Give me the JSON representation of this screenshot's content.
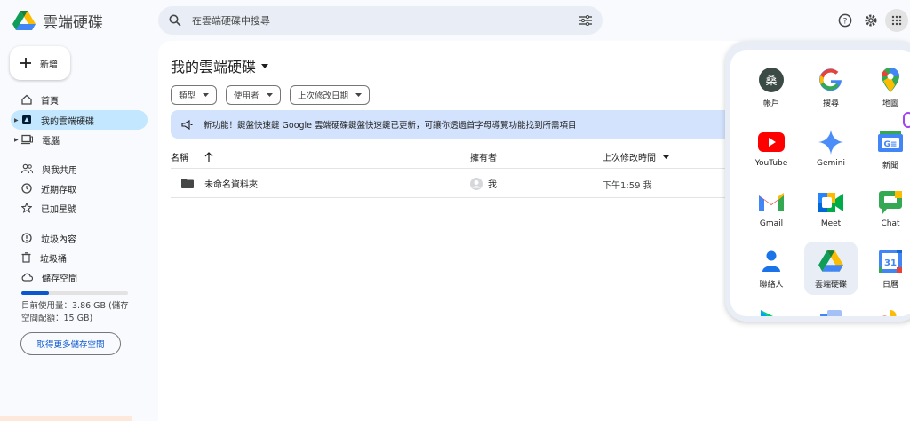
{
  "header": {
    "title": "雲端硬碟",
    "search_placeholder": "在雲端硬碟中搜尋",
    "icons": [
      "drive-logo-icon",
      "search-icon",
      "filter-options-icon",
      "help-icon",
      "settings-icon",
      "apps-grid-icon"
    ]
  },
  "sidebar": {
    "new_label": "新增",
    "items": [
      {
        "label": "首頁",
        "icon": "home-icon"
      },
      {
        "label": "我的雲端硬碟",
        "icon": "my-drive-icon"
      },
      {
        "label": "電腦",
        "icon": "computer-icon"
      },
      {
        "label": "與我共用",
        "icon": "shared-icon"
      },
      {
        "label": "近期存取",
        "icon": "clock-icon"
      },
      {
        "label": "已加星號",
        "icon": "star-icon"
      },
      {
        "label": "垃圾內容",
        "icon": "spam-icon"
      },
      {
        "label": "垃圾桶",
        "icon": "trash-icon"
      },
      {
        "label": "儲存空間",
        "icon": "cloud-icon"
      }
    ],
    "storage_text": "目前使用量：3.86 GB (儲存空間配額：15 GB)",
    "storage_fraction": 0.26,
    "more_storage_label": "取得更多儲存空間"
  },
  "main": {
    "title": "我的雲端硬碟",
    "filters": [
      "類型",
      "使用者",
      "上次修改日期"
    ],
    "banner": "新功能！鍵盤快速鍵 Google 雲端硬碟鍵盤快速鍵已更新，可讓你透過首字母導覽功能找到所需項目",
    "columns": {
      "name": "名稱",
      "owner": "擁有者",
      "modified": "上次修改時間"
    },
    "rows": [
      {
        "name": "未命名資料夾",
        "owner": "我",
        "modified": "下午1:59 我"
      }
    ]
  },
  "apps_panel": {
    "apps": [
      {
        "label": "帳戶",
        "avatar_letter": "桑"
      },
      {
        "label": "搜尋"
      },
      {
        "label": "地圖"
      },
      {
        "label": "YouTube"
      },
      {
        "label": "Gemini"
      },
      {
        "label": "新聞"
      },
      {
        "label": "Gmail"
      },
      {
        "label": "Meet"
      },
      {
        "label": "Chat"
      },
      {
        "label": "聯絡人"
      },
      {
        "label": "雲端硬碟"
      },
      {
        "label": "日曆",
        "calendar_day": "31"
      }
    ]
  },
  "colors": {
    "accent": "#0b57d0",
    "active_nav": "#c2e7ff",
    "banner": "#d3e3fd",
    "background": "#f8fafd"
  }
}
